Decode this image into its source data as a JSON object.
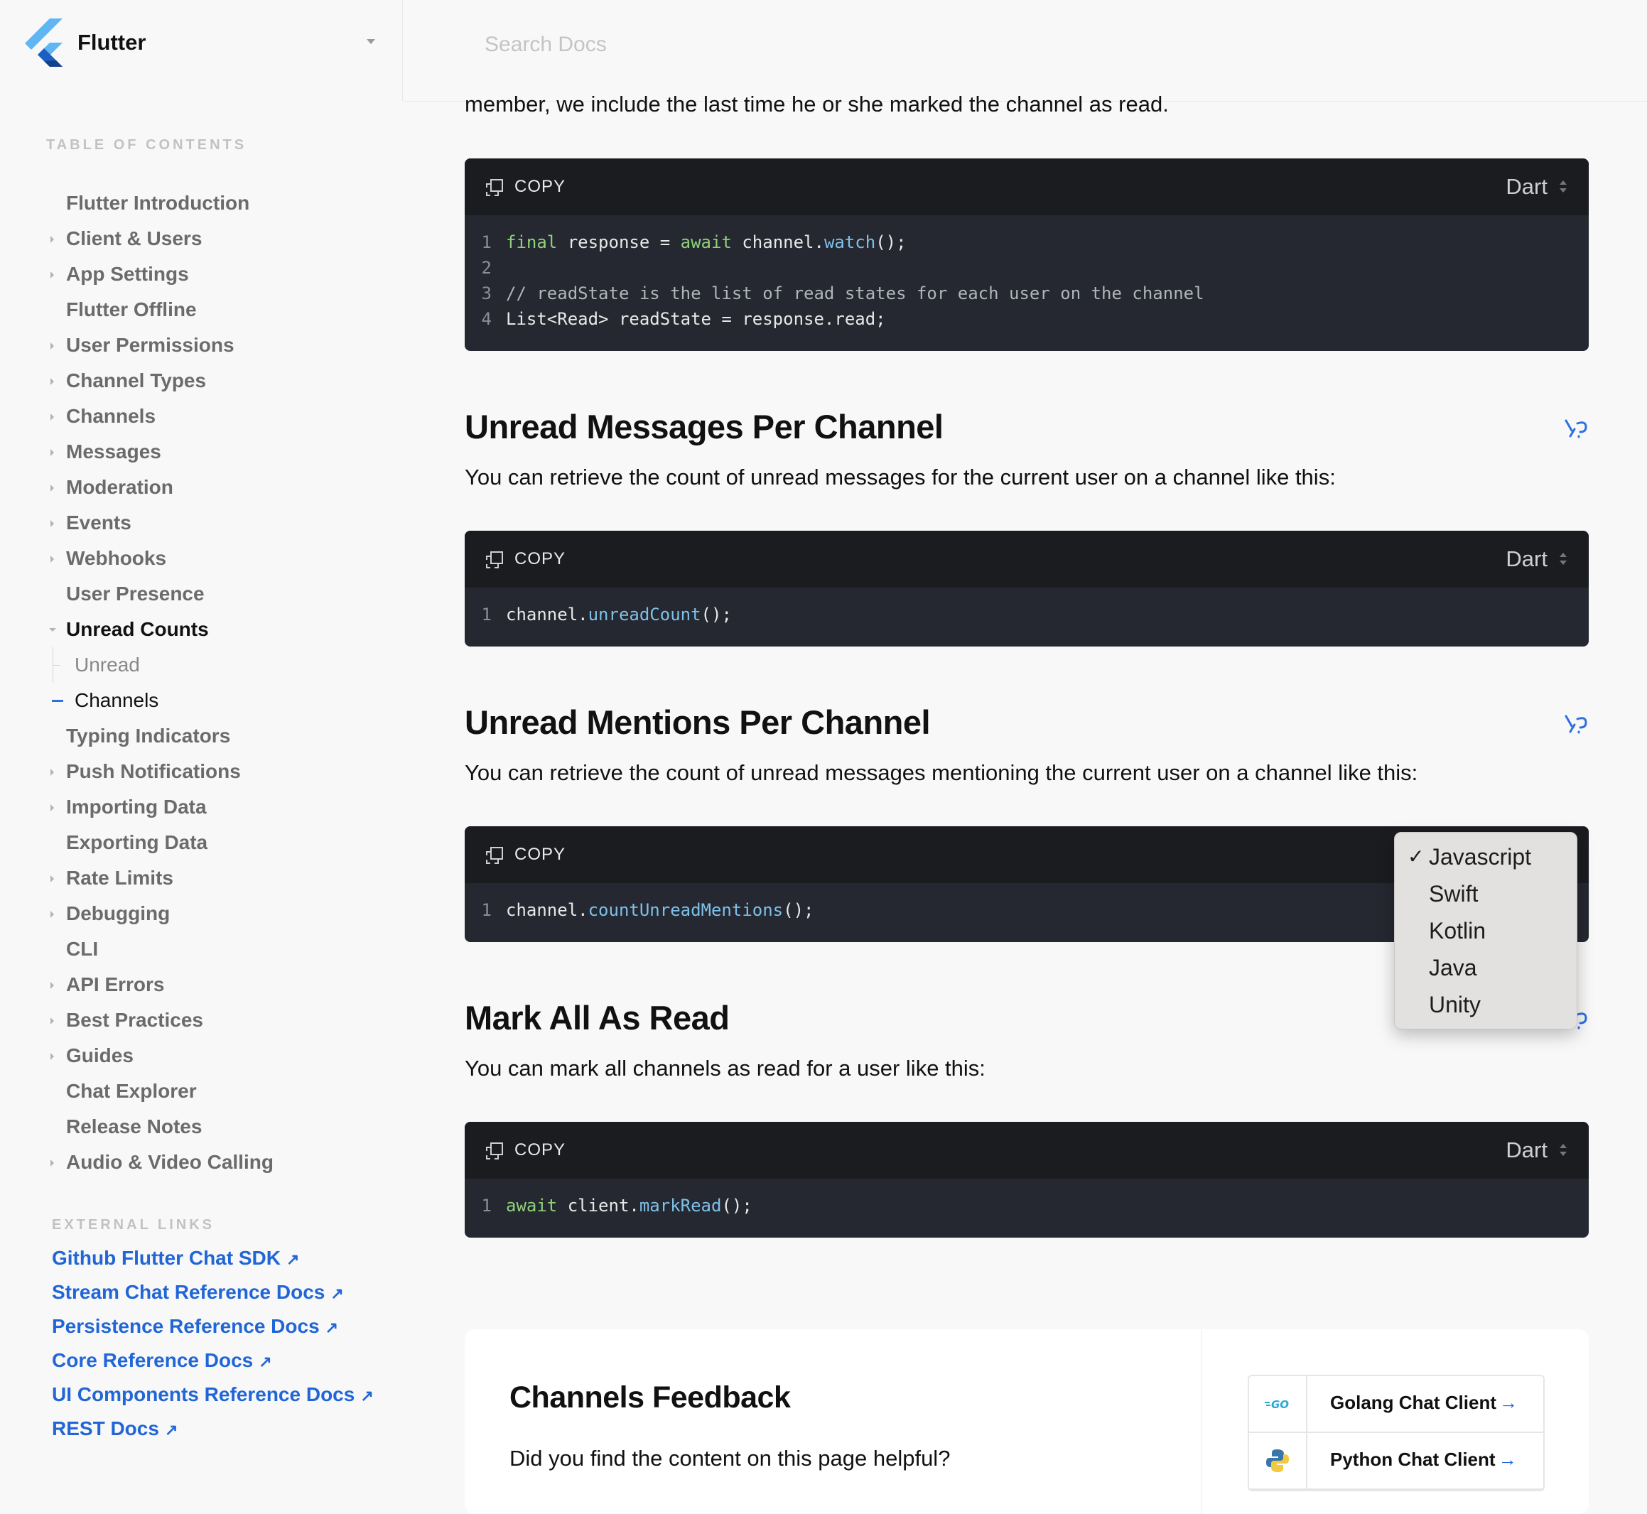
{
  "header": {
    "brand": "Flutter",
    "search_placeholder": "Search Docs"
  },
  "sidebar": {
    "toc_title": "TABLE OF CONTENTS",
    "items": [
      {
        "label": "Flutter Introduction",
        "arrow": false
      },
      {
        "label": "Client & Users",
        "arrow": true
      },
      {
        "label": "App Settings",
        "arrow": true
      },
      {
        "label": "Flutter Offline",
        "arrow": false
      },
      {
        "label": "User Permissions",
        "arrow": true
      },
      {
        "label": "Channel Types",
        "arrow": true
      },
      {
        "label": "Channels",
        "arrow": true
      },
      {
        "label": "Messages",
        "arrow": true
      },
      {
        "label": "Moderation",
        "arrow": true
      },
      {
        "label": "Events",
        "arrow": true
      },
      {
        "label": "Webhooks",
        "arrow": true
      },
      {
        "label": "User Presence",
        "arrow": false
      },
      {
        "label": "Unread Counts",
        "arrow": true,
        "active": true
      },
      {
        "label": "Unread",
        "sub": true
      },
      {
        "label": "Channels",
        "sub": true,
        "current": true
      },
      {
        "label": "Typing Indicators",
        "arrow": false
      },
      {
        "label": "Push Notifications",
        "arrow": true
      },
      {
        "label": "Importing Data",
        "arrow": true
      },
      {
        "label": "Exporting Data",
        "arrow": false
      },
      {
        "label": "Rate Limits",
        "arrow": true
      },
      {
        "label": "Debugging",
        "arrow": true
      },
      {
        "label": "CLI",
        "arrow": false
      },
      {
        "label": "API Errors",
        "arrow": true
      },
      {
        "label": "Best Practices",
        "arrow": true
      },
      {
        "label": "Guides",
        "arrow": true
      },
      {
        "label": "Chat Explorer",
        "arrow": false
      },
      {
        "label": "Release Notes",
        "arrow": false
      },
      {
        "label": "Audio & Video Calling",
        "arrow": true
      }
    ],
    "external_title": "EXTERNAL LINKS",
    "external_links": [
      "Github Flutter Chat SDK",
      "Stream Chat Reference Docs",
      "Persistence Reference Docs",
      "Core Reference Docs",
      "UI Components Reference Docs",
      "REST Docs"
    ]
  },
  "main": {
    "cut_text": "member, we include the last time he or she marked the channel as read.",
    "copy_label": "COPY",
    "block1": {
      "lang": "Dart",
      "lines": [
        {
          "n": "1",
          "k1": "final",
          "t1": " response = ",
          "k2": "await",
          "t2": " channel.",
          "f": "watch",
          "t3": "();"
        },
        {
          "n": "2"
        },
        {
          "n": "3",
          "c": "// readState is the list of read states for each user on the channel"
        },
        {
          "n": "4",
          "t0": "List<Read> readState = response.read;"
        }
      ]
    },
    "section1": {
      "title": "Unread Messages Per Channel",
      "desc": "You can retrieve the count of unread messages for the current user on a channel like this:"
    },
    "block2": {
      "lang": "Dart",
      "n": "1",
      "t1": "channel.",
      "f": "unreadCount",
      "t2": "();"
    },
    "section2": {
      "title": "Unread Mentions Per Channel",
      "desc": "You can retrieve the count of unread messages mentioning the current user on a channel like this:"
    },
    "block3": {
      "n": "1",
      "t1": "channel.",
      "f": "countUnreadMentions",
      "t2": "();"
    },
    "section3": {
      "title": "Mark All As Read",
      "desc": "You can mark all channels as read for a user like this:"
    },
    "block4": {
      "lang": "Dart",
      "n": "1",
      "k": "await",
      "t1": " client.",
      "f": "markRead",
      "t2": "();"
    },
    "dropdown": {
      "check": "✓",
      "options": [
        "Javascript",
        "Swift",
        "Kotlin",
        "Java",
        "Unity"
      ],
      "selected": "Javascript"
    }
  },
  "feedback": {
    "title": "Channels Feedback",
    "question": "Did you find the content on this page helpful?",
    "clients": [
      {
        "label": "Golang Chat Client",
        "icon_text": "GO"
      },
      {
        "label": "Python Chat Client"
      }
    ],
    "arrow": "→"
  },
  "colors": {
    "link": "#2166d6",
    "code_bg": "#252830",
    "code_head_bg": "#1b1c20",
    "keyword": "#8fd17a",
    "function": "#7ec0e8"
  }
}
